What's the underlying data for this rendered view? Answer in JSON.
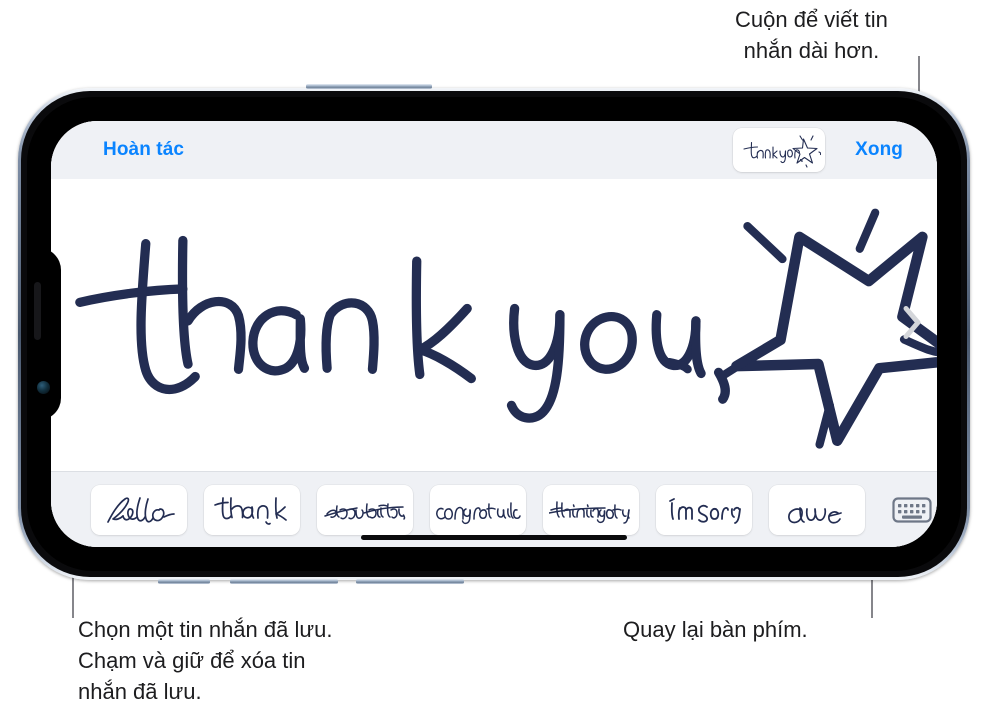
{
  "callouts": {
    "top_right": "Cuộn để viết tin\nnhắn dài hơn.",
    "bottom_left": "Chọn một tin nhắn đã lưu.\nChạm và giữ để xóa tin\nnhắn đã lưu.",
    "bottom_right": "Quay lại bàn phím."
  },
  "toolbar": {
    "undo_label": "Hoàn tác",
    "done_label": "Xong",
    "thumbnail_name": "thank-you-star-thumbnail"
  },
  "canvas": {
    "content_description": "thank you",
    "drawing": "hand-drawn star with sparkles",
    "ink_color": "#232d52",
    "background": "#ffffff",
    "scroll_indicator": "chevron-right-icon"
  },
  "saved_messages": {
    "cards": [
      {
        "text": "hello",
        "style": "script"
      },
      {
        "text": "thank you",
        "style": "print"
      },
      {
        "text": "happy birthday",
        "style": "slant"
      },
      {
        "text": "congratulations",
        "style": "print"
      },
      {
        "text": "thinking of you",
        "style": "slant"
      },
      {
        "text": "I'm sorry",
        "style": "print"
      },
      {
        "text": "awe",
        "style": "script",
        "clipped": true
      }
    ],
    "keyboard_button": "keyboard-icon"
  },
  "colors": {
    "ios_blue": "#0a84ff",
    "ink": "#232d52",
    "chrome_bg": "#eff1f5",
    "annotation_text": "#1d1d1f",
    "leader_line": "#86868b",
    "keyboard_icon": "#6e7787"
  }
}
